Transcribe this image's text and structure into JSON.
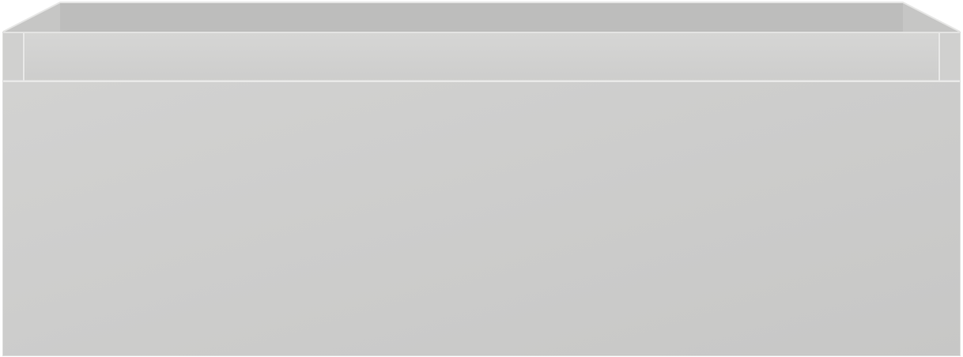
{
  "object": {
    "kind": "drawer-box",
    "colors": {
      "front_panel": "#cbcbca",
      "front_panel_highlight": "#d4d4d3",
      "top_rim": "#d2d2d1",
      "inner_back_wall": "#bdbdbc",
      "inner_side_wall": "#c6c6c5",
      "edge_line": "#e6e6e5",
      "shadow_line": "#b3b3b2"
    }
  }
}
